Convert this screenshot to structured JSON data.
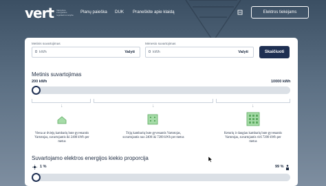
{
  "header": {
    "logo_word": "vert",
    "logo_tagline": "Valstybinė energetikos reguliavimo taryba",
    "nav": [
      "Planų paieška",
      "DUK",
      "Praneškite apie klaidą"
    ],
    "supplier_button": "Elektros tiekėjams",
    "print_icon": "print-icon"
  },
  "form": {
    "annual_label": "Metinis suvartojimas",
    "monthly_label": "Mėnesio suvartojimas",
    "annual_value": "0",
    "monthly_value": "0",
    "unit": "kWh",
    "clear_label": "Valyti",
    "calculate_label": "Skaičiuoti"
  },
  "annual_slider": {
    "title": "Metinis suvartojimas",
    "min_label": "200 kWh",
    "max_label": "10000 kWh",
    "value_fraction": 0
  },
  "categories": [
    {
      "icon": "small-house-icon",
      "text": "Viena ar dviejų kambarių bute gyvenantis Vartotojas, suvartojantis iki 2400 kWh per metus"
    },
    {
      "icon": "medium-building-icon",
      "text": "Trijų kambarių bute gyvenantis Vartotojas, suvartojantis nuo 2400 iki 7200 kWh per metus"
    },
    {
      "icon": "large-building-icon",
      "text": "Keturių ir daugiau kambarių bute gyvenantis Vartotojas, suvartojantis virš 7200 kWh per metus"
    }
  ],
  "proportion": {
    "title": "Suvartojamo elektros energijos kiekio proporcija",
    "left_label": "1 %",
    "right_label": "99 %",
    "left_icon": "sun-icon",
    "right_icon": "person-icon",
    "value_fraction": 0.01
  },
  "colors": {
    "primary": "#1e2f52",
    "accent_green": "#7cc47f",
    "track": "#dbe0e6"
  }
}
